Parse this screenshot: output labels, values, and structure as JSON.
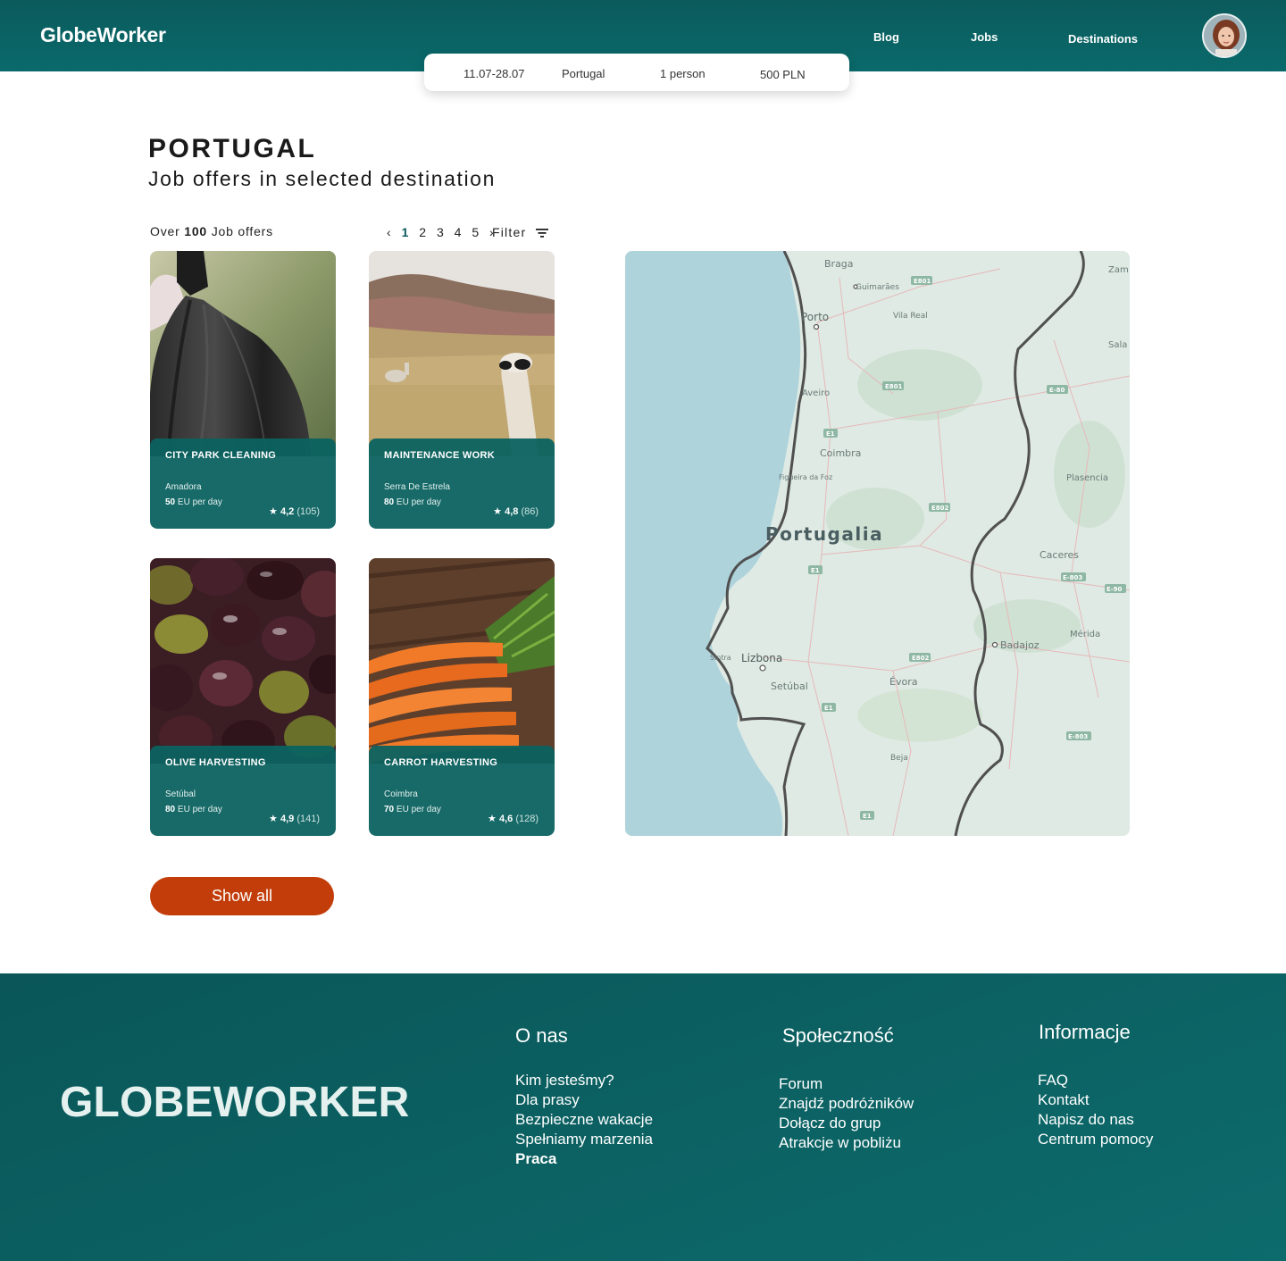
{
  "header": {
    "logo": "GlobeWorker",
    "nav": [
      "Blog",
      "Jobs",
      "Destinations"
    ]
  },
  "search": {
    "dates": "11.07-28.07",
    "destination": "Portugal",
    "people": "1 person",
    "budget": "500 PLN"
  },
  "main": {
    "title": "PORTUGAL",
    "subtitle": "Job offers in selected destination",
    "count_prefix": "Over",
    "count_value": "100",
    "count_suffix": "Job offers",
    "pagination": {
      "prev": "‹",
      "pages": [
        "1",
        "2",
        "3",
        "4",
        "5"
      ],
      "next": "›",
      "active": "1"
    },
    "filter_label": "Filter",
    "show_all": "Show all"
  },
  "jobs": [
    {
      "title": "CITY PARK CLEANING",
      "location": "Amadora",
      "pay_value": "50",
      "pay_unit": "EU per day",
      "rating": "4,2",
      "reviews": "(105)"
    },
    {
      "title": "MAINTENANCE WORK",
      "location": "Serra De Estrela",
      "pay_value": "80",
      "pay_unit": "EU per day",
      "rating": "4,8",
      "reviews": "(86)"
    },
    {
      "title": "OLIVE HARVESTING",
      "location": "Setúbal",
      "pay_value": "80",
      "pay_unit": "EU per day",
      "rating": "4,9",
      "reviews": "(141)"
    },
    {
      "title": "CARROT HARVESTING",
      "location": "Coimbra",
      "pay_value": "70",
      "pay_unit": "EU per day",
      "rating": "4,6",
      "reviews": "(128)"
    }
  ],
  "map": {
    "country_label": "Portugalia",
    "cities": [
      "Braga",
      "Guimarães",
      "Porto",
      "Vila Real",
      "Aveiro",
      "Coimbra",
      "Figueira da Foz",
      "Lizbona",
      "Sintra",
      "Setúbal",
      "Évora",
      "Beja",
      "Plasencia",
      "Caceres",
      "Badajoz",
      "Mérida",
      "Zam",
      "Sala"
    ],
    "roads": [
      "E801",
      "E80",
      "E1",
      "E802",
      "E803",
      "E90",
      "E-80",
      "E-803",
      "E-90"
    ]
  },
  "footer": {
    "brand": "GLOBEWORKER",
    "columns": [
      {
        "title": "O nas",
        "links": [
          "Kim jesteśmy?",
          "Dla prasy",
          "Bezpieczne wakacje",
          "Spełniamy marzenia",
          "Praca"
        ]
      },
      {
        "title": "Społeczność",
        "links": [
          "Forum",
          "Znajdź podróżników",
          "Dołącz do grup",
          "Atrakcje w pobliżu"
        ]
      },
      {
        "title": "Informacje",
        "links": [
          "FAQ",
          "Kontakt",
          "Napisz do nas",
          "Centrum pomocy"
        ]
      }
    ]
  },
  "colors": {
    "brand_teal": "#0b5a5c",
    "accent_orange": "#c23d0a",
    "map_sea": "#aed3db",
    "map_land": "#dde9e3"
  }
}
